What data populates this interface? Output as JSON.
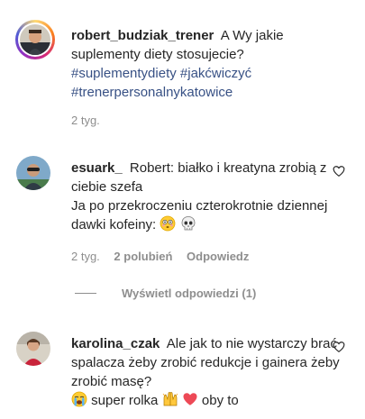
{
  "comments": [
    {
      "username": "robert_budziak_trener",
      "text": "A Wy jakie suplementy diety stosujecie?",
      "hashtags": [
        "#suplementydiety",
        "#jakćwiczyć",
        "#trenerpersonalnykatowice"
      ],
      "time": "2 tyg."
    },
    {
      "username": "esuark_",
      "line1": "Robert: białko i kreatyna zrobią z ciebie szefa",
      "line2": "Ja po przekroczeniu czterokrotnie dziennej dawki kofeiny:",
      "time": "2 tyg.",
      "likes": "2 polubień",
      "reply": "Odpowiedz",
      "view_replies": "Wyświetl odpowiedzi (1)"
    },
    {
      "username": "karolina_czak",
      "text": "Ale jak to nie wystarczy brać spalacza żeby zrobić redukcje i gainera żeby zrobić masę?",
      "tail1": "super rolka",
      "tail2": "oby to"
    }
  ],
  "icons": {
    "like": "heart-outline-icon",
    "emoji_flushed": "flushed-face-emoji",
    "emoji_skull": "skull-emoji",
    "emoji_crying": "loudly-crying-face-emoji",
    "emoji_hands": "raising-hands-emoji",
    "emoji_heart": "red-heart-emoji"
  },
  "colors": {
    "text": "#262626",
    "secondary": "#8e8e8e",
    "hashtag": "#385185",
    "heart_red": "#ed4956"
  }
}
